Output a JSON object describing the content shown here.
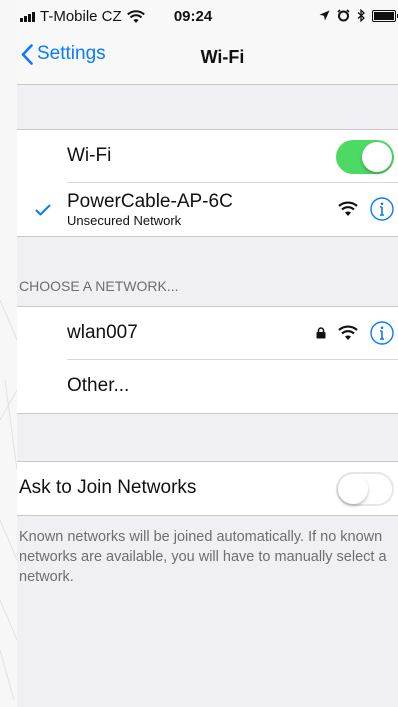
{
  "status_bar": {
    "carrier": "T-Mobile CZ",
    "time": "09:24"
  },
  "nav": {
    "back_label": "Settings",
    "title": "Wi-Fi"
  },
  "wifi_group": {
    "wifi_label": "Wi-Fi",
    "wifi_enabled": true,
    "connected_network": {
      "name": "PowerCable-AP-6C",
      "subtitle": "Unsecured Network"
    }
  },
  "networks_section": {
    "header": "CHOOSE A NETWORK...",
    "networks": [
      {
        "name": "wlan007",
        "locked": true
      }
    ],
    "other_label": "Other..."
  },
  "ask_group": {
    "label": "Ask to Join Networks",
    "enabled": false,
    "footer": "Known networks will be joined automatically. If no known networks are available, you will have to manually select a network."
  },
  "colors": {
    "accent": "#0a7aff",
    "toggle_on": "#4cd964",
    "background": "#efeff4"
  }
}
